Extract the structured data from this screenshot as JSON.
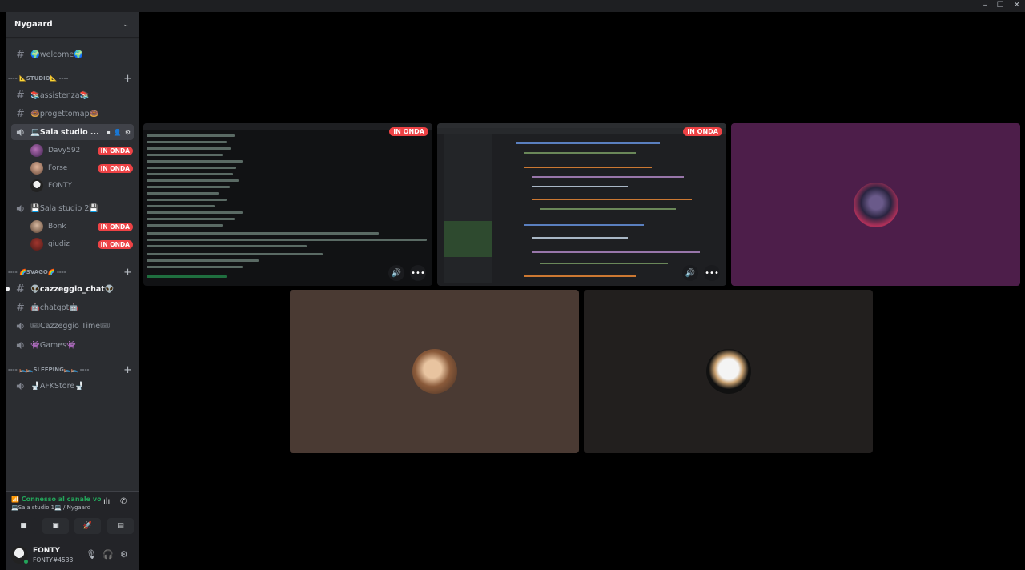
{
  "window": {
    "minimize": "–",
    "maximize": "☐",
    "close": "✕"
  },
  "server": {
    "name": "Nygaard"
  },
  "channels": {
    "welcome": "🌍welcome🌍",
    "cat_studio": "---- 📐STUDIO📐 ----",
    "assistenza": "📚assistenza📚",
    "progettomap": "🍩progettomap🍩",
    "sala_studio_1": "💻Sala studio ...",
    "sala_studio_2": "💾Sala studio 2💾",
    "cat_svago": "---- 🌈SVAGO🌈 ----",
    "cazzeggio_chat": "👽cazzeggio_chat👽",
    "chatgpt": "🤖chatgpt🤖",
    "cazzeggio_time": "🎟Cazzeggio Time🎟",
    "games": "👾Games👾",
    "cat_sleeping": "---- 🛌🛌SLEEPING🛌🛌 ----",
    "afkstore": "🚽AFKStore🚽"
  },
  "voice_users_1": [
    {
      "name": "Davy592",
      "live": "IN ONDA"
    },
    {
      "name": "Forse",
      "live": "IN ONDA"
    },
    {
      "name": "FONTY",
      "live": ""
    }
  ],
  "voice_users_2": [
    {
      "name": "Bonk",
      "live": "IN ONDA"
    },
    {
      "name": "giudiz",
      "live": "IN ONDA"
    }
  ],
  "voice_panel": {
    "status": "Connesso al canale vocale",
    "location": "💻Sala studio 1💻 / Nygaard"
  },
  "user": {
    "name": "FONTY",
    "tag": "FONTY#4533"
  },
  "stage": {
    "live_badge": "IN ONDA"
  },
  "colors": {
    "live": "#ed4245",
    "connected": "#23a55a",
    "tile_purple": "#4d1e4a",
    "tile_brown": "#4a3a33",
    "tile_dark": "#221f1e"
  }
}
